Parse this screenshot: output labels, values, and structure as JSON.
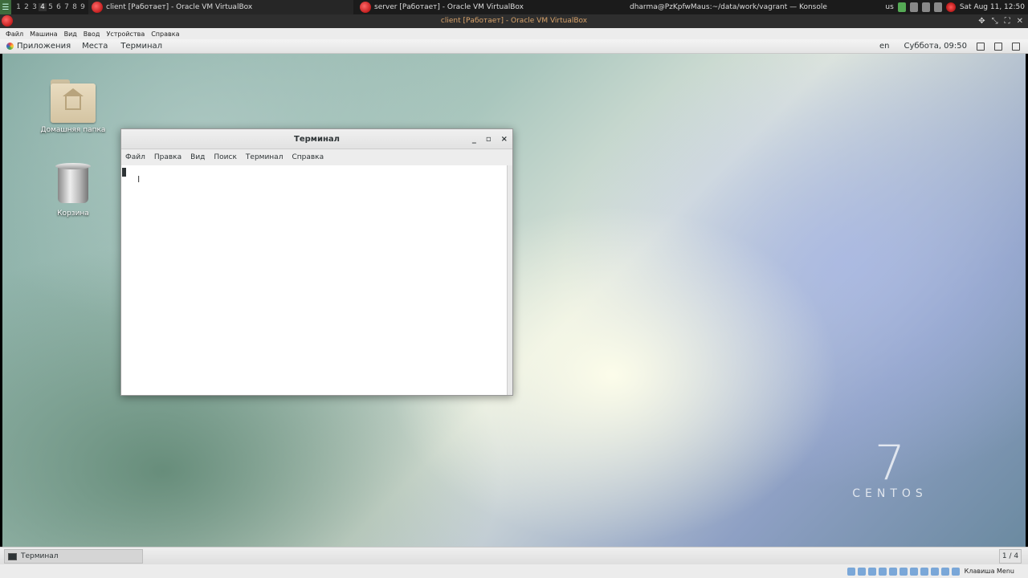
{
  "host": {
    "workspaces": [
      "1",
      "2",
      "3",
      "4",
      "5",
      "6",
      "7",
      "8",
      "9"
    ],
    "active_workspace": "4",
    "tasks": [
      {
        "title": "client [Работает] - Oracle VM VirtualBox"
      },
      {
        "title": "server [Работает] - Oracle VM VirtualBox"
      },
      {
        "title": "dharma@PzKpfwMaus:~/data/work/vagrant — Konsole"
      }
    ],
    "keyboard_layout": "us",
    "clock": "Sat Aug 11, 12:50"
  },
  "vbox": {
    "window_title": "client [Работает] - Oracle VM VirtualBox",
    "menu": [
      "Файл",
      "Машина",
      "Вид",
      "Ввод",
      "Устройства",
      "Справка"
    ],
    "status_hostkey": "Клавиша Menu"
  },
  "gnome": {
    "applications": "Приложения",
    "places": "Места",
    "terminal_app": "Терминал",
    "lang": "en",
    "clock": "Суббота, 09:50"
  },
  "desktop": {
    "icons": [
      {
        "label": "Домашняя папка",
        "icon": "home-folder-icon"
      },
      {
        "label": "Корзина",
        "icon": "trash-icon"
      }
    ],
    "logo_number": "7",
    "logo_name": "CENTOS"
  },
  "terminal": {
    "title": "Терминал",
    "menu": [
      "Файл",
      "Правка",
      "Вид",
      "Поиск",
      "Терминал",
      "Справка"
    ],
    "minimize": "_",
    "maximize": "▫",
    "close": "×"
  },
  "bottom_panel": {
    "task_label": "Терминал",
    "workspace": "1 / 4"
  }
}
